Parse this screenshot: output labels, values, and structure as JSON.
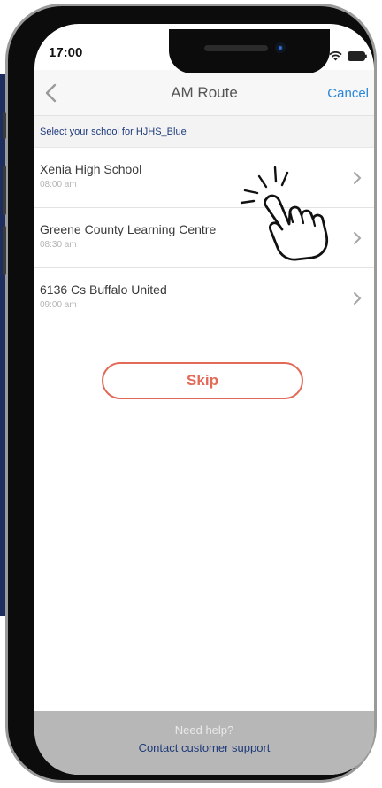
{
  "status_bar": {
    "time": "17:00",
    "icons": [
      "signal-icon",
      "wifi-icon",
      "battery-icon"
    ]
  },
  "nav": {
    "back_icon": "chevron-left-icon",
    "title": "AM Route",
    "cancel_label": "Cancel"
  },
  "section_header": "Select your school for HJHS_Blue",
  "schools": [
    {
      "name": "Xenia High School",
      "time": "08:00 am"
    },
    {
      "name": "Greene County Learning Centre",
      "time": "08:30 am"
    },
    {
      "name": "6136 Cs Buffalo United",
      "time": "09:00 am"
    }
  ],
  "skip_label": "Skip",
  "footer": {
    "help_text": "Need help?",
    "support_link": "Contact customer support"
  },
  "colors": {
    "accent": "#2a86d8",
    "skip": "#e36a59",
    "header_text": "#1e3a7a",
    "footer_bg": "#b7b7b7",
    "side_panel": "#1d2e5e"
  }
}
